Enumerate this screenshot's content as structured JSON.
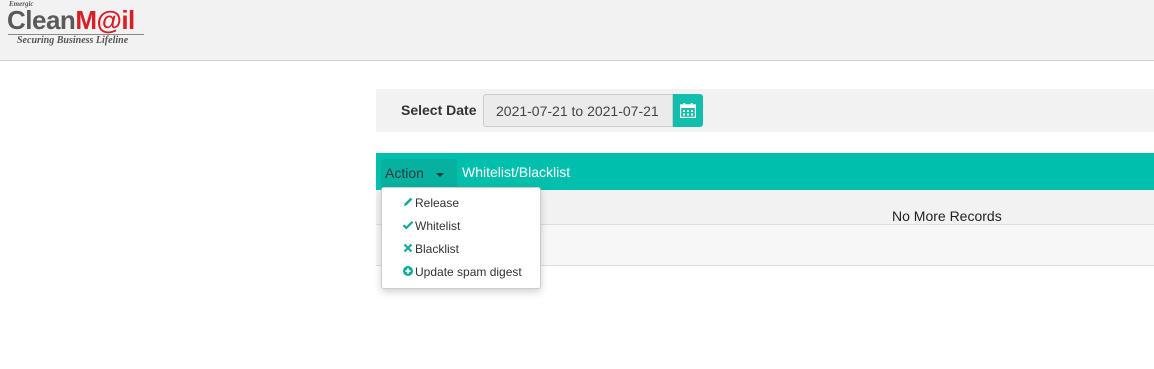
{
  "header": {
    "logo_small": "Emergic",
    "logo_clean": "Clean",
    "logo_mail": "M@il",
    "logo_tagline": "Securing Business Lifeline"
  },
  "filter": {
    "label": "Select Date",
    "date_range": "2021-07-21 to 2021-07-21",
    "calendar_icon": "calendar-icon"
  },
  "action_bar": {
    "action_label": "Action",
    "whitelist_blacklist_label": "Whitelist/Blacklist"
  },
  "records": {
    "empty_message": "No More Records"
  },
  "dropdown": {
    "items": [
      {
        "label": "Release",
        "icon": "pencil-icon"
      },
      {
        "label": "Whitelist",
        "icon": "check-icon"
      },
      {
        "label": "Blacklist",
        "icon": "x-icon"
      },
      {
        "label": "Update spam digest",
        "icon": "plus-circle-icon"
      }
    ]
  },
  "colors": {
    "accent": "#00c0ad",
    "header_bg": "#f2f2f2",
    "brand_red": "#d81f26"
  }
}
